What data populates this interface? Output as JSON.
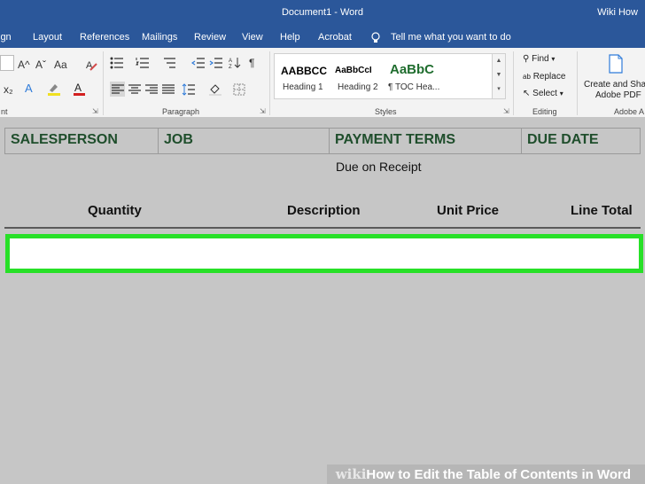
{
  "window": {
    "title": "Document1 - Word",
    "user": "Wiki How"
  },
  "ribbon_tabs": [
    "ign",
    "Layout",
    "References",
    "Mailings",
    "Review",
    "View",
    "Help",
    "Acrobat"
  ],
  "tell_me": {
    "icon": "lightbulb-icon",
    "text": "Tell me what you want to do"
  },
  "groups": {
    "font": "nt",
    "paragraph": "Paragraph",
    "styles": "Styles",
    "editing": "Editing",
    "adobe": "Adobe A"
  },
  "font_controls": {
    "grow": "A^",
    "shrink": "Aˇ",
    "case": "Aa",
    "sub": "x₂"
  },
  "styles": [
    {
      "sample": "AABBCC",
      "name": "Heading 1"
    },
    {
      "sample": "AaBbCcI",
      "name": "Heading 2"
    },
    {
      "sample": "AaBbC",
      "name": "¶ TOC Hea..."
    }
  ],
  "editing": {
    "find": "Find",
    "replace": "Replace",
    "select": "Select"
  },
  "adobe": {
    "line1": "Create and Sha",
    "line2": "Adobe PDF"
  },
  "document": {
    "header_cells": [
      "SALESPERSON",
      "JOB",
      "PAYMENT TERMS",
      "DUE DATE"
    ],
    "payment_terms_value": "Due on Receipt",
    "line_columns": [
      "Quantity",
      "Description",
      "Unit Price",
      "Line Total"
    ]
  },
  "colors": {
    "ribbon_blue": "#2b579a",
    "highlight_green": "#27e027",
    "header_text": "#1f4e2c"
  },
  "watermark": {
    "logo": "wiki",
    "text": "How to Edit the Table of Contents in Word"
  }
}
